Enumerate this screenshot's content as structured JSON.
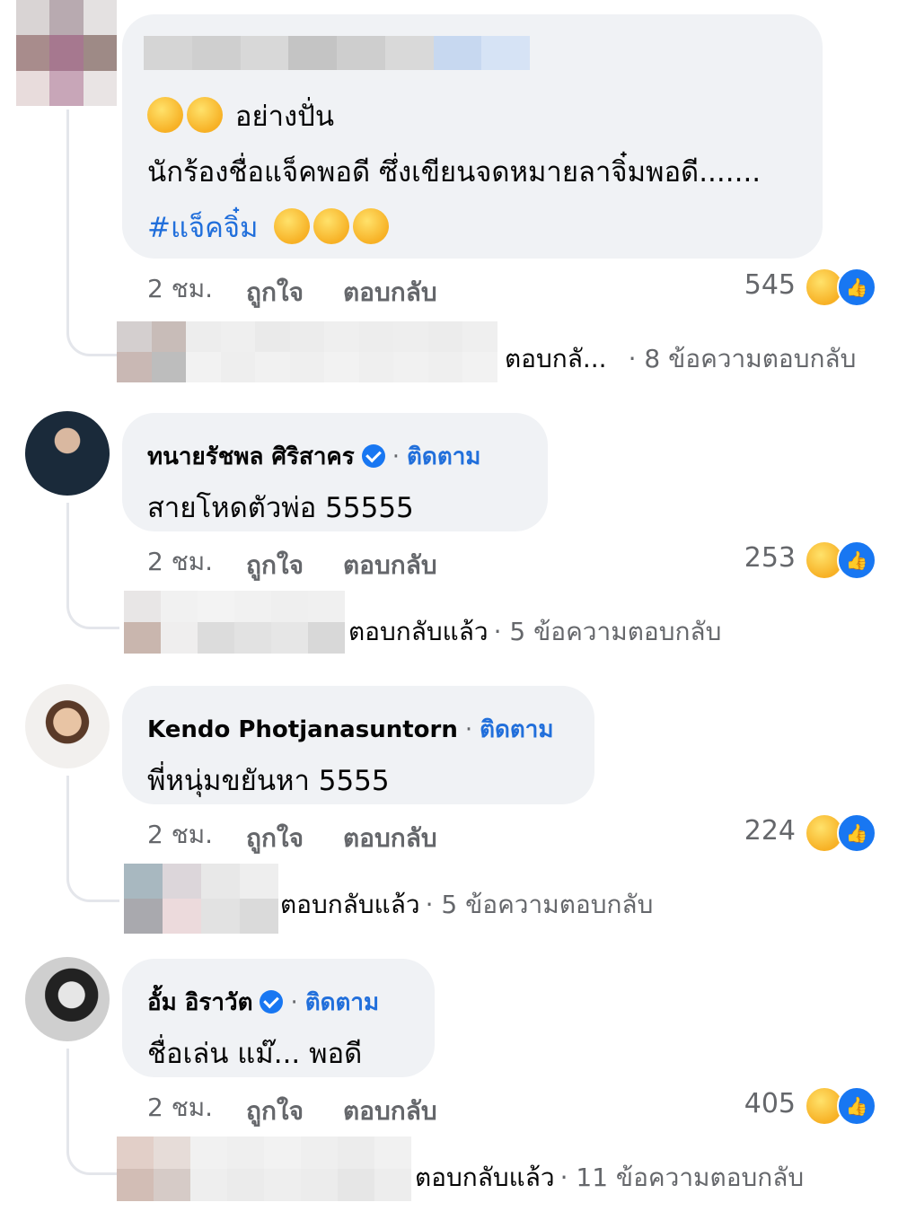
{
  "comments": [
    {
      "author": "",
      "text_line1": "อย่างปั่น",
      "text_line2": "นักร้องชื่อแจ็คพอดี ซึ่งเขียนจดหมายลาจิ๋มพอดี.......",
      "hashtag": "#แจ็คจิ๋ม",
      "time": "2 ชม.",
      "like_label": "ถูกใจ",
      "reply_label": "ตอบกลับ",
      "reaction_count": "545",
      "reply_preview": "ตอบกลั...",
      "reply_count": "· 8 ข้อความตอบกลับ"
    },
    {
      "author": "ทนายรัชพล ศิริสาคร",
      "verified": true,
      "follow": "ติดตาม",
      "text": "สายโหดตัวพ่อ 55555",
      "time": "2 ชม.",
      "like_label": "ถูกใจ",
      "reply_label": "ตอบกลับ",
      "reaction_count": "253",
      "reply_preview": "ตอบกลับแล้ว",
      "reply_count": "· 5 ข้อความตอบกลับ"
    },
    {
      "author": "Kendo Photjanasuntorn",
      "verified": false,
      "follow": "ติดตาม",
      "text": "พี่หนุ่มขยันหา 5555",
      "time": "2 ชม.",
      "like_label": "ถูกใจ",
      "reply_label": "ตอบกลับ",
      "reaction_count": "224",
      "reply_preview": "ตอบกลับแล้ว",
      "reply_count": "· 5 ข้อความตอบกลับ"
    },
    {
      "author": "อั้ม อิราวัต",
      "verified": true,
      "follow": "ติดตาม",
      "text": "ชื่อเล่น แม๊... พอดี",
      "time": "2 ชม.",
      "like_label": "ถูกใจ",
      "reply_label": "ตอบกลับ",
      "reaction_count": "405",
      "reply_preview": "ตอบกลับแล้ว",
      "reply_count": "· 11 ข้อความตอบกลับ"
    }
  ],
  "colors": {
    "bubble": "#f0f2f5",
    "link": "#216fdb",
    "meta": "#65676b",
    "like_blue": "#1877f2"
  },
  "icons": [
    "haha-reaction-icon",
    "like-reaction-icon",
    "verified-badge-icon"
  ]
}
